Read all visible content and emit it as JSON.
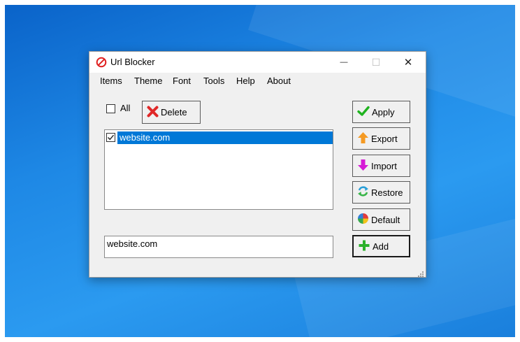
{
  "window": {
    "title": "Url Blocker",
    "minimize_glyph": "—",
    "maximize_glyph": "☐",
    "close_glyph": "✕"
  },
  "menu": {
    "items": [
      "Items",
      "Theme",
      "Font",
      "Tools",
      "Help",
      "About"
    ]
  },
  "controls": {
    "all_label": "All",
    "all_checked": false,
    "delete_label": "Delete"
  },
  "list": {
    "items": [
      {
        "text": "website.com",
        "checked": true,
        "selected": true
      }
    ]
  },
  "input": {
    "value": "website.com"
  },
  "buttons": {
    "apply": "Apply",
    "export": "Export",
    "import": "Import",
    "restore": "Restore",
    "default": "Default",
    "add": "Add"
  },
  "icons": {
    "app": "prohibited-icon",
    "delete": "red-x-icon",
    "apply": "green-check-icon",
    "export": "orange-up-arrow-icon",
    "import": "magenta-down-arrow-icon",
    "restore": "refresh-icon",
    "default": "color-wheel-icon",
    "add": "green-plus-icon"
  },
  "colors": {
    "selection": "#0078d7",
    "desktop": "#1e88e5"
  }
}
